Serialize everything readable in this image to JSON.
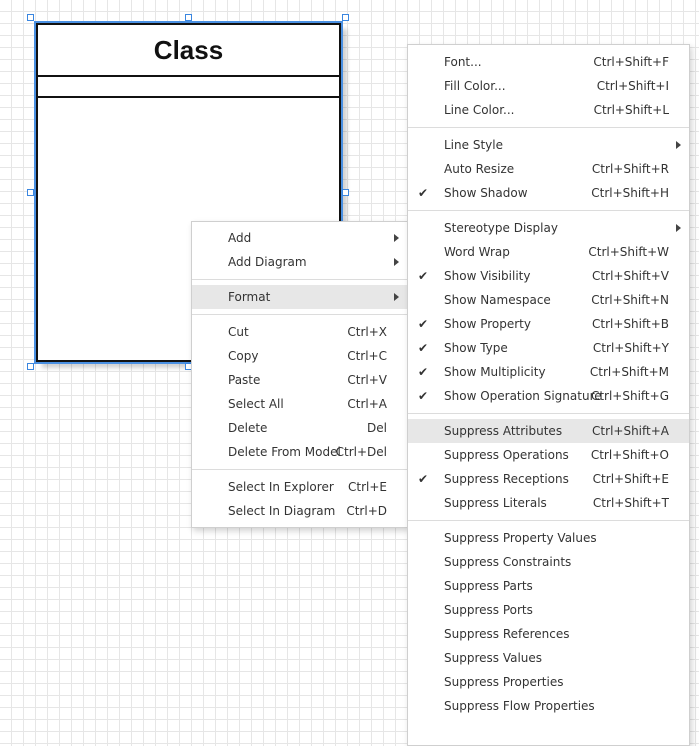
{
  "diagram": {
    "class_name": "Class"
  },
  "context_menu": {
    "groups": [
      [
        {
          "label": "Add",
          "submenu": true
        },
        {
          "label": "Add Diagram",
          "submenu": true
        }
      ],
      [
        {
          "label": "Format",
          "submenu": true,
          "highlighted": true
        }
      ],
      [
        {
          "label": "Cut",
          "shortcut": "Ctrl+X"
        },
        {
          "label": "Copy",
          "shortcut": "Ctrl+C"
        },
        {
          "label": "Paste",
          "shortcut": "Ctrl+V"
        },
        {
          "label": "Select All",
          "shortcut": "Ctrl+A"
        },
        {
          "label": "Delete",
          "shortcut": "Del"
        },
        {
          "label": "Delete From Model",
          "shortcut": "Ctrl+Del"
        }
      ],
      [
        {
          "label": "Select In Explorer",
          "shortcut": "Ctrl+E"
        },
        {
          "label": "Select In Diagram",
          "shortcut": "Ctrl+D"
        }
      ]
    ]
  },
  "format_menu": {
    "groups": [
      [
        {
          "label": "Font...",
          "shortcut": "Ctrl+Shift+F"
        },
        {
          "label": "Fill Color...",
          "shortcut": "Ctrl+Shift+I"
        },
        {
          "label": "Line Color...",
          "shortcut": "Ctrl+Shift+L"
        }
      ],
      [
        {
          "label": "Line Style",
          "submenu": true
        },
        {
          "label": "Auto Resize",
          "shortcut": "Ctrl+Shift+R"
        },
        {
          "label": "Show Shadow",
          "shortcut": "Ctrl+Shift+H",
          "checked": true
        }
      ],
      [
        {
          "label": "Stereotype Display",
          "submenu": true
        },
        {
          "label": "Word Wrap",
          "shortcut": "Ctrl+Shift+W"
        },
        {
          "label": "Show Visibility",
          "shortcut": "Ctrl+Shift+V",
          "checked": true
        },
        {
          "label": "Show Namespace",
          "shortcut": "Ctrl+Shift+N"
        },
        {
          "label": "Show Property",
          "shortcut": "Ctrl+Shift+B",
          "checked": true
        },
        {
          "label": "Show Type",
          "shortcut": "Ctrl+Shift+Y",
          "checked": true
        },
        {
          "label": "Show Multiplicity",
          "shortcut": "Ctrl+Shift+M",
          "checked": true
        },
        {
          "label": "Show Operation Signature",
          "shortcut": "Ctrl+Shift+G",
          "checked": true
        }
      ],
      [
        {
          "label": "Suppress Attributes",
          "shortcut": "Ctrl+Shift+A",
          "highlighted": true
        },
        {
          "label": "Suppress Operations",
          "shortcut": "Ctrl+Shift+O"
        },
        {
          "label": "Suppress Receptions",
          "shortcut": "Ctrl+Shift+E",
          "checked": true
        },
        {
          "label": "Suppress Literals",
          "shortcut": "Ctrl+Shift+T"
        }
      ],
      [
        {
          "label": "Suppress Property Values"
        },
        {
          "label": "Suppress Constraints"
        },
        {
          "label": "Suppress Parts"
        },
        {
          "label": "Suppress Ports"
        },
        {
          "label": "Suppress References"
        },
        {
          "label": "Suppress Values"
        },
        {
          "label": "Suppress Properties"
        },
        {
          "label": "Suppress Flow Properties"
        }
      ]
    ]
  }
}
